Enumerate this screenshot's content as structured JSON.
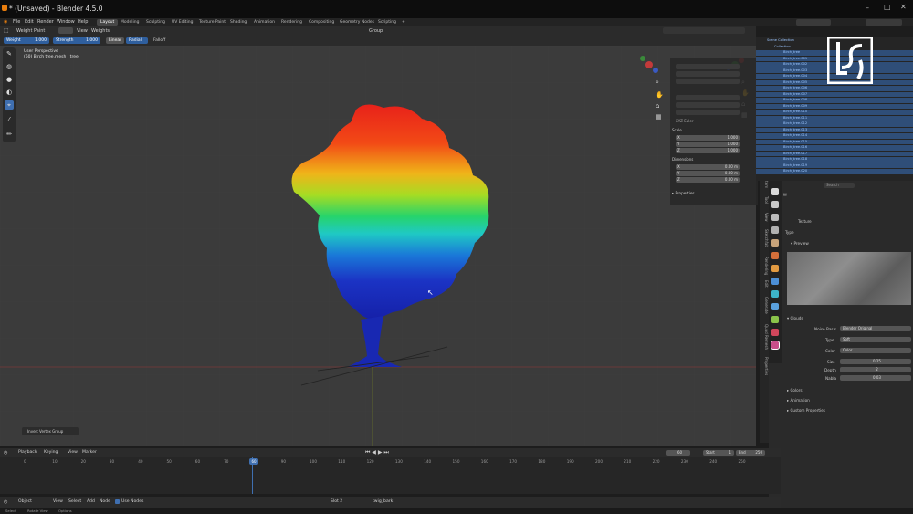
{
  "titlebar": {
    "title": "* (Unsaved) - Blender 4.5.0"
  },
  "menubar": {
    "items": [
      "File",
      "Edit",
      "Render",
      "Window",
      "Help"
    ],
    "workspaces": [
      "Layout",
      "Modeling",
      "Sculpting",
      "UV Editing",
      "Texture Paint",
      "Shading",
      "Animation",
      "Rendering",
      "Compositing",
      "Geometry Nodes",
      "Scripting"
    ],
    "add_workspace": "+"
  },
  "header3d": {
    "mode": "Weight Paint",
    "view": "View",
    "weights": "Weights",
    "group": "Group"
  },
  "toolopts": {
    "weight_label": "Weight",
    "weight_value": "1.000",
    "strength_label": "Strength",
    "strength_value": "1.000",
    "linear": "Linear",
    "radial": "Radial",
    "falloff": "Falloff"
  },
  "viewport": {
    "perspective": "User Perspective",
    "object": "(60) Birch tree.mesh | tree",
    "redo_panel": "Invert Vertex Group"
  },
  "npanel": {
    "rotation_mode": "XYZ Euler",
    "scale_label": "Scale",
    "scale_values": [
      "1.000",
      "1.000",
      "1.000"
    ],
    "dimensions_label": "Dimensions",
    "dim_values": [
      "0.00 m",
      "0.00 m",
      "0.00 m"
    ],
    "properties": "Properties",
    "axis_labels": [
      "X",
      "Y",
      "Z"
    ]
  },
  "sidetabs": [
    "Item",
    "Tool",
    "View",
    "Sketchfab",
    "Rendering",
    "Edit",
    "Generate",
    "Quad Remesh",
    "Properties"
  ],
  "outliner": {
    "rows": [
      "Scene Collection",
      "Collection",
      "Birch_tree",
      "Birch_tree.001",
      "Birch_tree.002",
      "Birch_tree.003",
      "Birch_tree.004",
      "Birch_tree.005",
      "Birch_tree.006",
      "Birch_tree.007",
      "Birch_tree.008",
      "Birch_tree.009",
      "Birch_tree.010",
      "Birch_tree.011",
      "Birch_tree.012",
      "Birch_tree.013",
      "Birch_tree.014",
      "Birch_tree.015",
      "Birch_tree.016",
      "Birch_tree.017",
      "Birch_tree.018",
      "Birch_tree.019",
      "Birch_tree.020"
    ]
  },
  "props": {
    "search": "Search",
    "texture_name": "Texture",
    "type_label": "Type",
    "preview": "Preview",
    "clouds": "Clouds",
    "noise_basis_label": "Noise Basis",
    "noise_basis_value": "Blender Original",
    "type2_label": "Type",
    "type2_value": "Soft",
    "color_label": "Color",
    "color_value": "Color",
    "size_label": "Size",
    "size_value": "0.25",
    "depth_label": "Depth",
    "depth_value": "2",
    "nabla_label": "Nabla",
    "nabla_value": "0.03",
    "colors": "Colors",
    "animation": "Animation",
    "custom_props": "Custom Properties"
  },
  "timeline": {
    "playback": "Playback",
    "keying": "Keying",
    "view": "View",
    "marker": "Marker",
    "current_frame": "60",
    "start_label": "Start",
    "start_value": "1",
    "end_label": "End",
    "end_value": "250",
    "ticks": [
      "0",
      "10",
      "20",
      "30",
      "40",
      "50",
      "60",
      "70",
      "80",
      "90",
      "100",
      "110",
      "120",
      "130",
      "140",
      "150",
      "160",
      "170",
      "180",
      "190",
      "200",
      "210",
      "220",
      "230",
      "240",
      "250"
    ]
  },
  "statusbar": {
    "mode": "Object",
    "view": "View",
    "select": "Select",
    "add": "Add",
    "node": "Node",
    "use_nodes": "Use Nodes",
    "slot": "Slot 2",
    "material": "twig_bark"
  },
  "bottombar": {
    "items": [
      "Select",
      "Rotate View",
      "Options"
    ]
  },
  "colors": {
    "accent": "#3f6fb0",
    "selection": "#2f4e78"
  }
}
